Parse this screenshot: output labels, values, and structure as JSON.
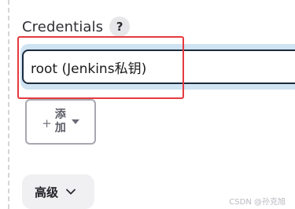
{
  "field": {
    "label": "Credentials",
    "help_glyph": "?",
    "selected_value": "root (Jenkins私钥)"
  },
  "add_button": {
    "plus_glyph": "+",
    "label": "添加",
    "icon": "caret-down-icon"
  },
  "advanced_button": {
    "label": "高级",
    "icon": "chevron-down-icon"
  },
  "watermark": {
    "text": "CSDN @孙克旭"
  },
  "colors": {
    "highlight_outline": "#e53a3f",
    "focus_ring": "#cfe3f2",
    "select_border": "#1b2a3c"
  }
}
